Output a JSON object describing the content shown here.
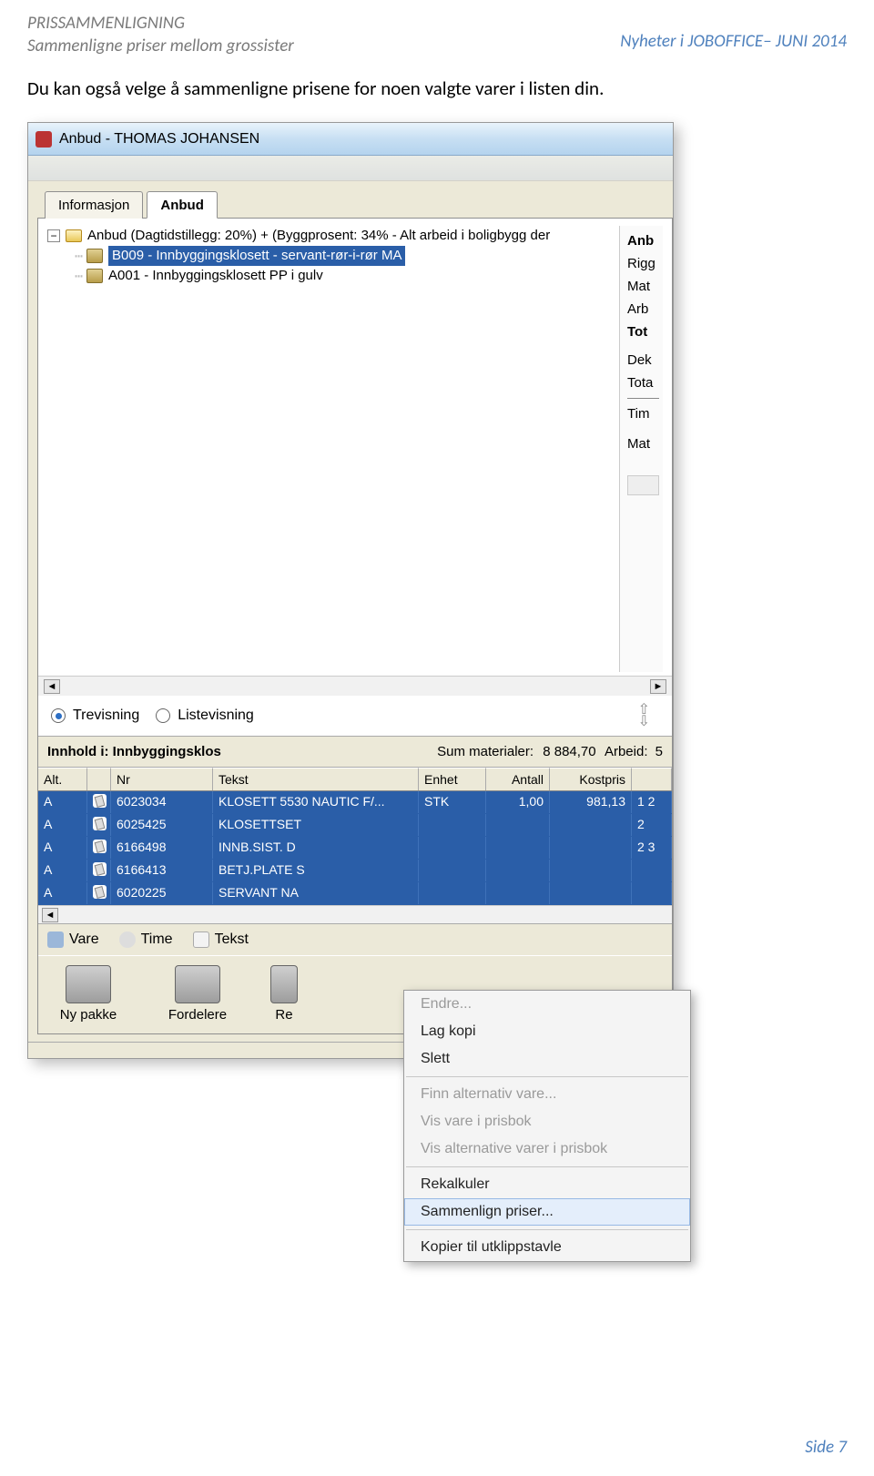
{
  "doc": {
    "header_title": "PRISSAMMENLIGNING",
    "header_sub": "Sammenligne priser mellom grossister",
    "header_right": "Nyheter i JOBOFFICE– JUNI 2014",
    "body_text": "Du kan også velge å sammenligne prisene for noen valgte varer i listen din.",
    "footer": "Side 7"
  },
  "window": {
    "title": "Anbud - THOMAS JOHANSEN",
    "dim_text": ""
  },
  "tabs": {
    "t1": "Informasjon",
    "t2": "Anbud"
  },
  "tree": {
    "root": "Anbud (Dagtidstillegg: 20%) + (Byggprosent: 34% - Alt arbeid i boligbygg der",
    "n1": "B009 - Innbyggingsklosett - servant-rør-i-rør MA",
    "n2": "A001 - Innbyggingsklosett  PP i gulv"
  },
  "right_strip": {
    "r0": "Anb",
    "r1": "Rigg",
    "r2": "Mat",
    "r3": "Arb",
    "r4": "Tot",
    "r5": "Dek",
    "r6": "Tota",
    "r7": "Tim",
    "r8": "Mat"
  },
  "views": {
    "v1": "Trevisning",
    "v2": "Listevisning"
  },
  "innhold": {
    "label": "Innhold i:",
    "value": "Innbyggingsklos",
    "sum_label": "Sum materialer:",
    "sum_val": "8 884,70",
    "arb_label": "Arbeid:",
    "arb_val": "5"
  },
  "grid_headers": {
    "alt": "Alt.",
    "nr": "Nr",
    "tekst": "Tekst",
    "enhet": "Enhet",
    "antall": "Antall",
    "kostpris": "Kostpris"
  },
  "grid_rows": [
    {
      "alt": "A",
      "nr": "6023034",
      "tekst": "KLOSETT 5530 NAUTIC F/...",
      "enhet": "STK",
      "antall": "1,00",
      "kostpris": "981,13",
      "end": "1 2"
    },
    {
      "alt": "A",
      "nr": "6025425",
      "tekst": "KLOSETTSET",
      "enhet": "",
      "antall": "",
      "kostpris": "",
      "end": "2"
    },
    {
      "alt": "A",
      "nr": "6166498",
      "tekst": "INNB.SIST. D",
      "enhet": "",
      "antall": "",
      "kostpris": "",
      "end": "2 3"
    },
    {
      "alt": "A",
      "nr": "6166413",
      "tekst": "BETJ.PLATE S",
      "enhet": "",
      "antall": "",
      "kostpris": "",
      "end": ""
    },
    {
      "alt": "A",
      "nr": "6020225",
      "tekst": "SERVANT NA",
      "enhet": "",
      "antall": "",
      "kostpris": "",
      "end": ""
    }
  ],
  "toolbar": {
    "vare": "Vare",
    "time": "Time",
    "tekst": "Tekst"
  },
  "bigtoolbar": {
    "nypakke": "Ny pakke",
    "fordelere": "Fordelere",
    "re": "Re"
  },
  "ctx": {
    "endre": "Endre...",
    "lagkopi": "Lag kopi",
    "slett": "Slett",
    "finnalt": "Finn alternativ vare...",
    "visvare": "Vis vare i prisbok",
    "visalt": "Vis alternative varer i prisbok",
    "rekalk": "Rekalkuler",
    "sammenlign": "Sammenlign priser...",
    "kopier": "Kopier til utklippstavle"
  }
}
